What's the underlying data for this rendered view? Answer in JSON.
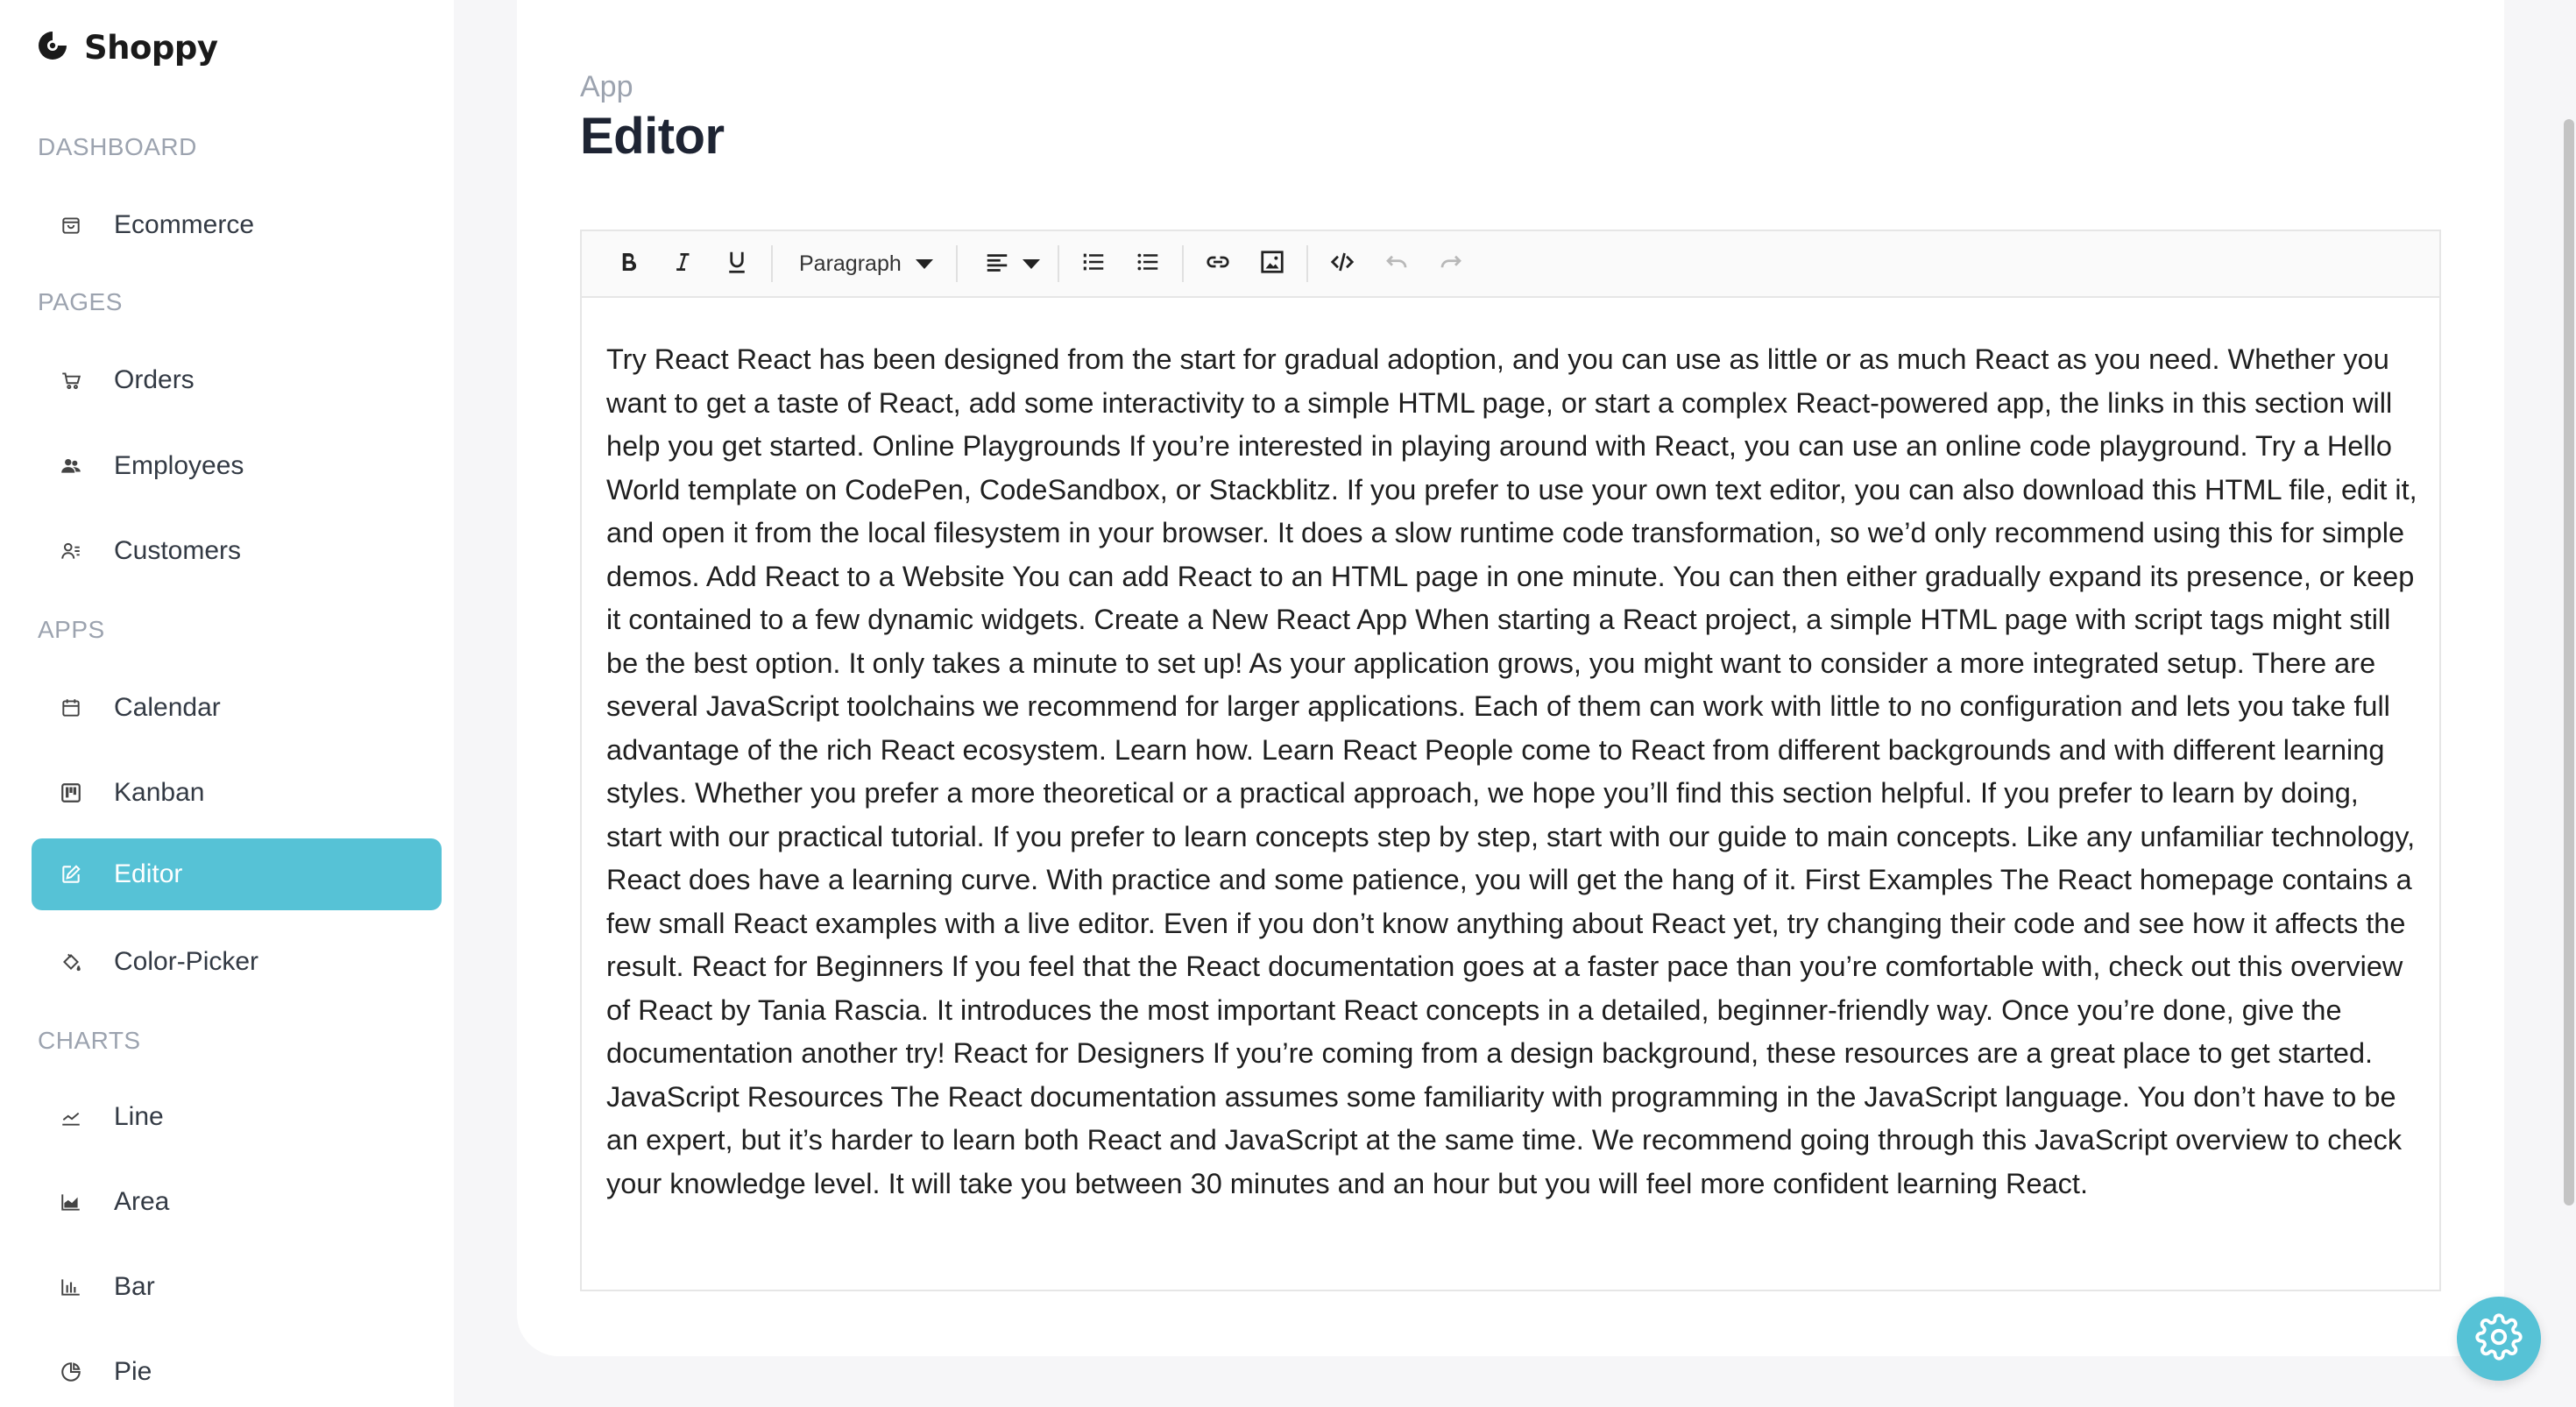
{
  "app": {
    "name": "Shoppy"
  },
  "sidebar": {
    "sections": [
      {
        "title": "DASHBOARD",
        "items": [
          {
            "label": "Ecommerce",
            "icon": "shopping-bag-icon"
          }
        ]
      },
      {
        "title": "PAGES",
        "items": [
          {
            "label": "Orders",
            "icon": "cart-icon"
          },
          {
            "label": "Employees",
            "icon": "people-icon"
          },
          {
            "label": "Customers",
            "icon": "contacts-icon"
          }
        ]
      },
      {
        "title": "APPS",
        "items": [
          {
            "label": "Calendar",
            "icon": "calendar-icon"
          },
          {
            "label": "Kanban",
            "icon": "kanban-icon"
          },
          {
            "label": "Editor",
            "icon": "edit-icon",
            "active": true
          },
          {
            "label": "Color-Picker",
            "icon": "paint-bucket-icon"
          }
        ]
      },
      {
        "title": "CHARTS",
        "items": [
          {
            "label": "Line",
            "icon": "line-chart-icon"
          },
          {
            "label": "Area",
            "icon": "area-chart-icon"
          },
          {
            "label": "Bar",
            "icon": "bar-chart-icon"
          },
          {
            "label": "Pie",
            "icon": "pie-chart-icon"
          }
        ]
      }
    ]
  },
  "header": {
    "breadcrumb": "App",
    "title": "Editor"
  },
  "editor": {
    "toolbar": {
      "format_select": "Paragraph",
      "buttons": [
        "bold-icon",
        "italic-icon",
        "underline-icon",
        "align-left-icon",
        "ordered-list-icon",
        "unordered-list-icon",
        "link-icon",
        "image-icon",
        "code-icon",
        "undo-icon",
        "redo-icon"
      ]
    },
    "content": "Try React React has been designed from the start for gradual adoption, and you can use as little or as much React as you need. Whether you want to get a taste of React, add some interactivity to a simple HTML page, or start a complex React-powered app, the links in this section will help you get started. Online Playgrounds If you’re interested in playing around with React, you can use an online code playground. Try a Hello World template on CodePen, CodeSandbox, or Stackblitz. If you prefer to use your own text editor, you can also download this HTML file, edit it, and open it from the local filesystem in your browser. It does a slow runtime code transformation, so we’d only recommend using this for simple demos. Add React to a Website You can add React to an HTML page in one minute. You can then either gradually expand its presence, or keep it contained to a few dynamic widgets. Create a New React App When starting a React project, a simple HTML page with script tags might still be the best option. It only takes a minute to set up! As your application grows, you might want to consider a more integrated setup. There are several JavaScript toolchains we recommend for larger applications. Each of them can work with little to no configuration and lets you take full advantage of the rich React ecosystem. Learn how. Learn React People come to React from different backgrounds and with different learning styles. Whether you prefer a more theoretical or a practical approach, we hope you’ll find this section helpful. If you prefer to learn by doing, start with our practical tutorial. If you prefer to learn concepts step by step, start with our guide to main concepts. Like any unfamiliar technology, React does have a learning curve. With practice and some patience, you will get the hang of it. First Examples The React homepage contains a few small React examples with a live editor. Even if you don’t know anything about React yet, try changing their code and see how it affects the result. React for Beginners If you feel that the React documentation goes at a faster pace than you’re comfortable with, check out this overview of React by Tania Rascia. It introduces the most important React concepts in a detailed, beginner-friendly way. Once you’re done, give the documentation another try! React for Designers If you’re coming from a design background, these resources are a great place to get started. JavaScript Resources The React documentation assumes some familiarity with programming in the JavaScript language. You don’t have to be an expert, but it’s harder to learn both React and JavaScript at the same time. We recommend going through this JavaScript overview to check your knowledge level. It will take you between 30 minutes and an hour but you will feel more confident learning React."
  },
  "settings": {
    "icon": "gear-icon"
  },
  "colors": {
    "accent": "#56c2d6",
    "sidebar_bg": "#ffffff",
    "page_bg": "#f6f6f8"
  }
}
